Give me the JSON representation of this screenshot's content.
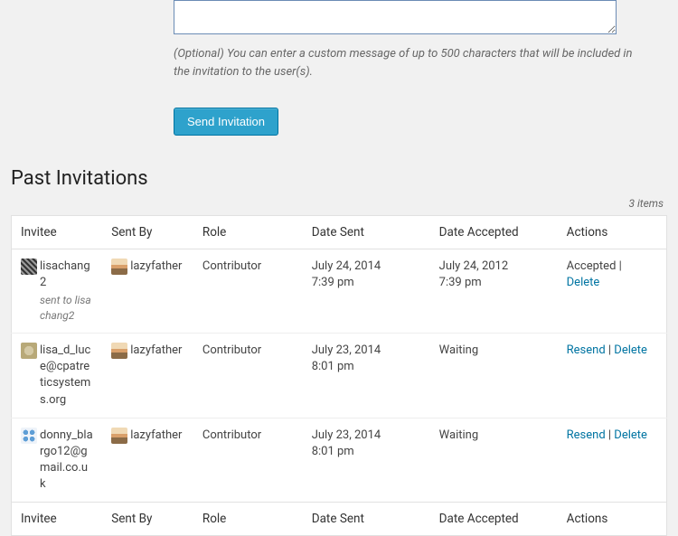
{
  "form": {
    "hint": "(Optional) You can enter a custom message of up to 500 characters that will be included in the invitation to the user(s).",
    "send_label": "Send Invitation"
  },
  "section": {
    "title": "Past Invitations",
    "items_count": "3 items"
  },
  "table": {
    "headers": {
      "invitee": "Invitee",
      "sent_by": "Sent By",
      "role": "Role",
      "date_sent": "Date Sent",
      "date_accepted": "Date Accepted",
      "actions": "Actions"
    },
    "rows": [
      {
        "invitee": "lisachang2",
        "sent_to_label": "sent to",
        "sent_to_value": "lisachang2",
        "sent_by": "lazyfather",
        "role": "Contributor",
        "date_sent_line1": "July 24, 2014",
        "date_sent_line2": "7:39 pm",
        "date_accepted_line1": "July 24, 2012",
        "date_accepted_line2": "7:39 pm",
        "status": "Accepted",
        "action1": "",
        "action2": "Delete"
      },
      {
        "invitee": "lisa_d_luce@cpatreticsystems.org",
        "sent_to_label": "",
        "sent_to_value": "",
        "sent_by": "lazyfather",
        "role": "Contributor",
        "date_sent_line1": "July 23, 2014",
        "date_sent_line2": "8:01 pm",
        "date_accepted_line1": "Waiting",
        "date_accepted_line2": "",
        "status": "",
        "action1": "Resend",
        "action2": "Delete"
      },
      {
        "invitee": "donny_blargo12@gmail.co.uk",
        "sent_to_label": "",
        "sent_to_value": "",
        "sent_by": "lazyfather",
        "role": "Contributor",
        "date_sent_line1": "July 23, 2014",
        "date_sent_line2": "8:01 pm",
        "date_accepted_line1": "Waiting",
        "date_accepted_line2": "",
        "status": "",
        "action1": "Resend",
        "action2": "Delete"
      }
    ]
  }
}
